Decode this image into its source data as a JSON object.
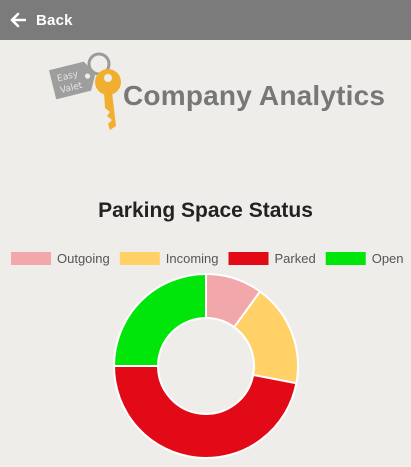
{
  "header": {
    "back_label": "Back",
    "background": "#7b7b7b"
  },
  "logo": {
    "tag_line1": "Easy",
    "tag_line2": "Valet",
    "title": "Company Analytics",
    "key_color": "#f2ae2e",
    "tag_color": "#9a9a9a"
  },
  "chart_data": {
    "type": "pie",
    "title": "Parking Space Status",
    "legend_position": "top",
    "categories": [
      "Outgoing",
      "Incoming",
      "Parked",
      "Open"
    ],
    "values": [
      10,
      18,
      47,
      25
    ],
    "colors": [
      "#f2a7ab",
      "#ffd166",
      "#e30a17",
      "#00e60a"
    ]
  }
}
